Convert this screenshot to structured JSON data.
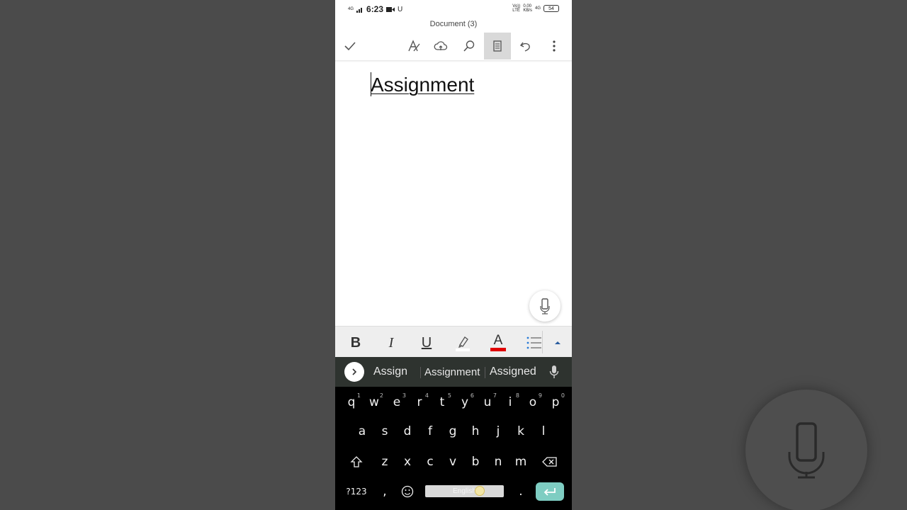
{
  "status_bar": {
    "time": "6:23",
    "signal": "4G",
    "carrier_badge": "U",
    "volte": "Vo))",
    "lte": "LTE",
    "net_speed": "0.00",
    "net_unit": "KB/s",
    "network2": "4G",
    "battery": "54"
  },
  "document": {
    "title": "Document (3)",
    "heading": "Assignment"
  },
  "toolbar": {
    "icons": [
      "check-icon",
      "draw-icon",
      "cloud-upload-icon",
      "search-icon",
      "reading-view-icon",
      "undo-icon",
      "more-icon"
    ]
  },
  "format_bar": {
    "bold": "B",
    "italic": "I",
    "underline": "U",
    "font_color": "A",
    "font_color_hex": "#e00000",
    "highlight_color_hex": "#ffffff"
  },
  "suggestions": [
    "Assign",
    "Assignment",
    "Assigned"
  ],
  "keyboard": {
    "row1": [
      {
        "k": "q",
        "n": "1"
      },
      {
        "k": "w",
        "n": "2"
      },
      {
        "k": "e",
        "n": "3"
      },
      {
        "k": "r",
        "n": "4"
      },
      {
        "k": "t",
        "n": "5"
      },
      {
        "k": "y",
        "n": "6"
      },
      {
        "k": "u",
        "n": "7"
      },
      {
        "k": "i",
        "n": "8"
      },
      {
        "k": "o",
        "n": "9"
      },
      {
        "k": "p",
        "n": "0"
      }
    ],
    "row2": [
      "a",
      "s",
      "d",
      "f",
      "g",
      "h",
      "j",
      "k",
      "l"
    ],
    "row3": [
      "z",
      "x",
      "c",
      "v",
      "b",
      "n",
      "m"
    ],
    "symbols_key": "?123",
    "comma_key": ",",
    "period_key": ".",
    "space_label": "English"
  }
}
